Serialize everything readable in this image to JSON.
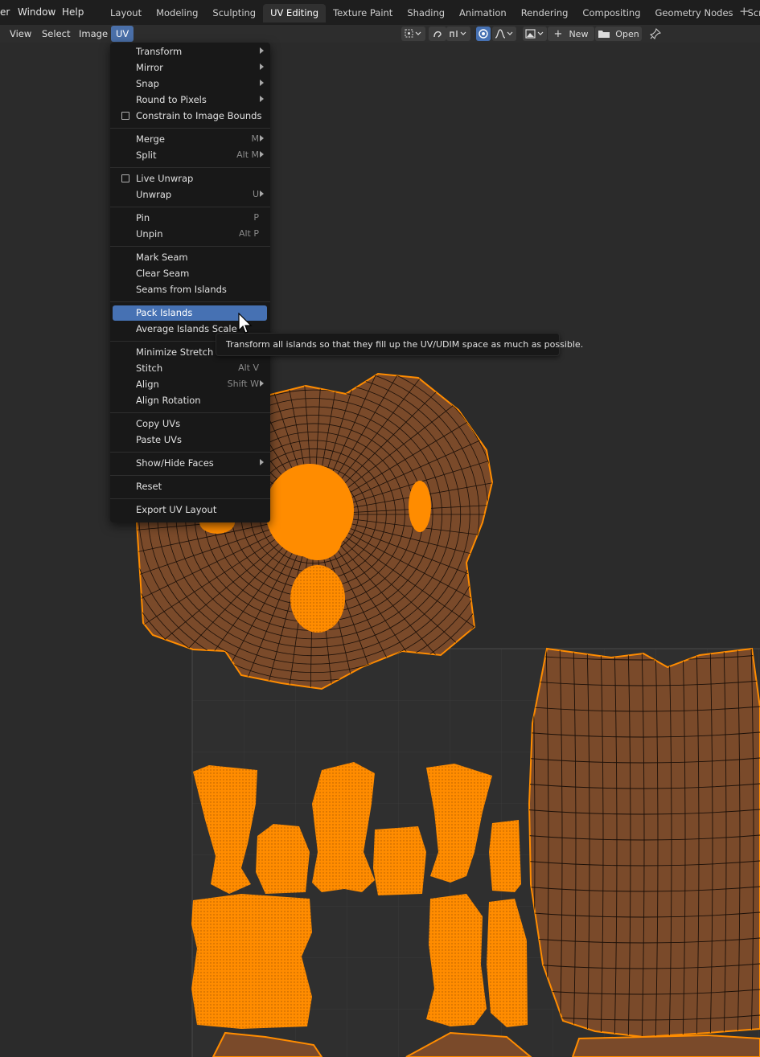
{
  "topbar": {
    "menus": [
      "er",
      "Window",
      "Help"
    ],
    "workspaces": [
      {
        "label": "Layout",
        "active": false
      },
      {
        "label": "Modeling",
        "active": false
      },
      {
        "label": "Sculpting",
        "active": false
      },
      {
        "label": "UV Editing",
        "active": true
      },
      {
        "label": "Texture Paint",
        "active": false
      },
      {
        "label": "Shading",
        "active": false
      },
      {
        "label": "Animation",
        "active": false
      },
      {
        "label": "Rendering",
        "active": false
      },
      {
        "label": "Compositing",
        "active": false
      },
      {
        "label": "Geometry Nodes",
        "active": false
      },
      {
        "label": "Scripting",
        "active": false
      }
    ],
    "add_icon": "plus-icon"
  },
  "header": {
    "menus": [
      "View",
      "Select",
      "Image",
      "UV"
    ],
    "new_label": "New",
    "open_label": "Open",
    "icons": [
      "pivot-icon",
      "sticky-select-icon",
      "snap-icon",
      "proportional-edit-icon",
      "falloff-icon",
      "image-browse-icon",
      "folder-icon",
      "pin-icon"
    ]
  },
  "uv_menu": {
    "items": [
      {
        "label": "Transform",
        "submenu": true
      },
      {
        "label": "Mirror",
        "submenu": true
      },
      {
        "label": "Snap",
        "submenu": true
      },
      {
        "label": "Round to Pixels",
        "submenu": true
      },
      {
        "label": "Constrain to Image Bounds",
        "checkbox": true
      },
      {
        "separator": true
      },
      {
        "label": "Merge",
        "shortcut": "M",
        "submenu": true
      },
      {
        "label": "Split",
        "shortcut": "Alt M",
        "submenu": true
      },
      {
        "separator": true
      },
      {
        "label": "Live Unwrap",
        "checkbox": true
      },
      {
        "label": "Unwrap",
        "shortcut": "U",
        "submenu": true
      },
      {
        "separator": true
      },
      {
        "label": "Pin",
        "shortcut": "P"
      },
      {
        "label": "Unpin",
        "shortcut": "Alt P"
      },
      {
        "separator": true
      },
      {
        "label": "Mark Seam"
      },
      {
        "label": "Clear Seam"
      },
      {
        "label": "Seams from Islands"
      },
      {
        "separator": true
      },
      {
        "label": "Pack Islands",
        "highlighted": true
      },
      {
        "label": "Average Islands Scale"
      },
      {
        "separator": true
      },
      {
        "label": "Minimize Stretch"
      },
      {
        "label": "Stitch",
        "shortcut": "Alt V"
      },
      {
        "label": "Align",
        "shortcut": "Shift W",
        "submenu": true
      },
      {
        "label": "Align Rotation"
      },
      {
        "separator": true
      },
      {
        "label": "Copy UVs"
      },
      {
        "label": "Paste UVs"
      },
      {
        "separator": true
      },
      {
        "label": "Show/Hide Faces",
        "submenu": true
      },
      {
        "separator": true
      },
      {
        "label": "Reset"
      },
      {
        "separator": true
      },
      {
        "label": "Export UV Layout"
      }
    ]
  },
  "tooltip": {
    "text": "Transform all islands so that they fill up the UV/UDIM space as much as possible."
  },
  "colors": {
    "uv_vertex": "#ff8c00",
    "uv_face": "#7a4a2a",
    "uv_edge": "#1a0f08",
    "highlight": "#4671b3",
    "background": "#2b2b2b",
    "grid": "#3a3a3a"
  }
}
